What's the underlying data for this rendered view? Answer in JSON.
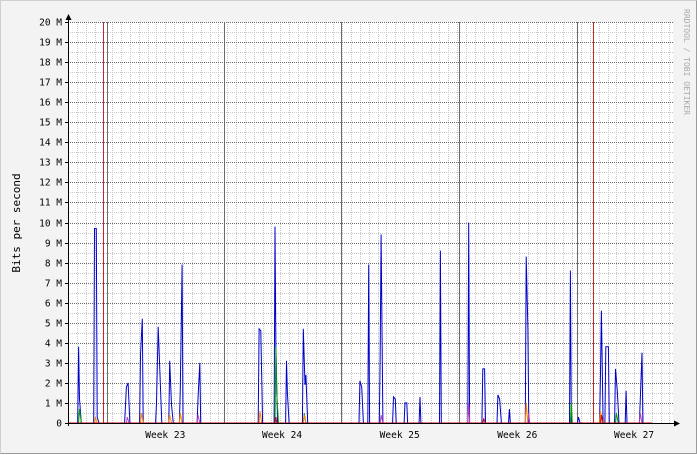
{
  "chart_data": {
    "type": "line",
    "title": "",
    "ylabel": "Bits per second",
    "watermark": "RRDTOOL / TOBI OETIKER",
    "ylim": [
      0,
      20000000
    ],
    "y_ticks": [
      {
        "value": 0,
        "label": "0"
      },
      {
        "value": 1000000,
        "label": "1 M"
      },
      {
        "value": 2000000,
        "label": "2 M"
      },
      {
        "value": 3000000,
        "label": "3 M"
      },
      {
        "value": 4000000,
        "label": "4 M"
      },
      {
        "value": 5000000,
        "label": "5 M"
      },
      {
        "value": 6000000,
        "label": "6 M"
      },
      {
        "value": 7000000,
        "label": "7 M"
      },
      {
        "value": 8000000,
        "label": "8 M"
      },
      {
        "value": 9000000,
        "label": "9 M"
      },
      {
        "value": 10000000,
        "label": "10 M"
      },
      {
        "value": 11000000,
        "label": "11 M"
      },
      {
        "value": 12000000,
        "label": "12 M"
      },
      {
        "value": 13000000,
        "label": "13 M"
      },
      {
        "value": 14000000,
        "label": "14 M"
      },
      {
        "value": 15000000,
        "label": "15 M"
      },
      {
        "value": 16000000,
        "label": "16 M"
      },
      {
        "value": 17000000,
        "label": "17 M"
      },
      {
        "value": 18000000,
        "label": "18 M"
      },
      {
        "value": 19000000,
        "label": "19 M"
      },
      {
        "value": 20000000,
        "label": "20 M"
      }
    ],
    "x_unit": "day",
    "xlim": [
      0,
      31
    ],
    "week_lines": [
      2.2,
      8.8,
      15.45,
      22.1,
      28.75
    ],
    "week_labels": [
      {
        "x": 5.5,
        "label": "Week 23"
      },
      {
        "x": 12.1,
        "label": "Week 24"
      },
      {
        "x": 18.75,
        "label": "Week 25"
      },
      {
        "x": 25.4,
        "label": "Week 26"
      },
      {
        "x": 32.0,
        "label": "Week 27"
      }
    ],
    "red_markers": [
      2.0,
      29.65
    ],
    "colors": {
      "primary": "#0000cc",
      "secondary": "#cc0000",
      "tertiary": "#00a000",
      "quaternary": "#bb44bb",
      "quinary": "#ff8800",
      "grid_major": "#6a6a6a",
      "grid_minor": "#c8c8c8",
      "marker": "#cc2222",
      "axis": "#000000"
    },
    "series": [
      {
        "color_key": "primary",
        "points": [
          [
            0.0,
            0
          ],
          [
            0.55,
            0
          ],
          [
            0.6,
            3800000
          ],
          [
            0.65,
            1200000
          ],
          [
            0.75,
            0
          ],
          [
            1.45,
            0
          ],
          [
            1.5,
            9700000
          ],
          [
            1.6,
            9700000
          ],
          [
            1.65,
            300000
          ],
          [
            1.75,
            0
          ],
          [
            3.2,
            0
          ],
          [
            3.3,
            1800000
          ],
          [
            3.4,
            2000000
          ],
          [
            3.5,
            0
          ],
          [
            4.05,
            0
          ],
          [
            4.1,
            3400000
          ],
          [
            4.2,
            5200000
          ],
          [
            4.25,
            0
          ],
          [
            4.95,
            0
          ],
          [
            5.0,
            1000000
          ],
          [
            5.1,
            4800000
          ],
          [
            5.2,
            2400000
          ],
          [
            5.3,
            0
          ],
          [
            5.7,
            0
          ],
          [
            5.75,
            3100000
          ],
          [
            5.85,
            900000
          ],
          [
            5.95,
            0
          ],
          [
            6.3,
            0
          ],
          [
            6.35,
            1700000
          ],
          [
            6.45,
            7900000
          ],
          [
            6.5,
            0
          ],
          [
            7.3,
            0
          ],
          [
            7.35,
            1200000
          ],
          [
            7.45,
            3000000
          ],
          [
            7.5,
            0
          ],
          [
            10.75,
            0
          ],
          [
            10.8,
            4700000
          ],
          [
            10.9,
            4600000
          ],
          [
            11.0,
            0
          ],
          [
            11.65,
            0
          ],
          [
            11.7,
            9800000
          ],
          [
            11.75,
            3700000
          ],
          [
            11.85,
            0
          ],
          [
            12.3,
            0
          ],
          [
            12.35,
            3100000
          ],
          [
            12.4,
            1500000
          ],
          [
            12.5,
            0
          ],
          [
            13.25,
            0
          ],
          [
            13.3,
            4700000
          ],
          [
            13.4,
            1900000
          ],
          [
            13.45,
            2400000
          ],
          [
            13.55,
            0
          ],
          [
            16.45,
            0
          ],
          [
            16.5,
            2100000
          ],
          [
            16.6,
            1800000
          ],
          [
            16.7,
            0
          ],
          [
            16.95,
            0
          ],
          [
            17.0,
            7900000
          ],
          [
            17.05,
            0
          ],
          [
            17.6,
            0
          ],
          [
            17.65,
            3500000
          ],
          [
            17.7,
            9400000
          ],
          [
            17.8,
            0
          ],
          [
            18.35,
            0
          ],
          [
            18.4,
            1300000
          ],
          [
            18.5,
            1200000
          ],
          [
            18.55,
            0
          ],
          [
            19.0,
            0
          ],
          [
            19.05,
            1000000
          ],
          [
            19.15,
            1000000
          ],
          [
            19.2,
            0
          ],
          [
            19.85,
            0
          ],
          [
            19.9,
            1300000
          ],
          [
            19.95,
            0
          ],
          [
            21.0,
            0
          ],
          [
            21.05,
            8600000
          ],
          [
            21.1,
            0
          ],
          [
            22.6,
            0
          ],
          [
            22.65,
            10000000
          ],
          [
            22.7,
            0
          ],
          [
            23.4,
            0
          ],
          [
            23.45,
            2700000
          ],
          [
            23.55,
            2700000
          ],
          [
            23.6,
            0
          ],
          [
            24.25,
            0
          ],
          [
            24.3,
            1400000
          ],
          [
            24.4,
            1200000
          ],
          [
            24.5,
            0
          ],
          [
            24.9,
            0
          ],
          [
            24.95,
            700000
          ],
          [
            25.0,
            0
          ],
          [
            25.85,
            0
          ],
          [
            25.9,
            8300000
          ],
          [
            26.0,
            4700000
          ],
          [
            26.05,
            0
          ],
          [
            28.35,
            0
          ],
          [
            28.4,
            7600000
          ],
          [
            28.45,
            0
          ],
          [
            28.8,
            0
          ],
          [
            28.85,
            300000
          ],
          [
            28.95,
            0
          ],
          [
            30.05,
            0
          ],
          [
            30.1,
            2500000
          ],
          [
            30.15,
            5600000
          ],
          [
            30.25,
            0
          ],
          [
            30.35,
            0
          ],
          [
            30.4,
            3800000
          ],
          [
            30.55,
            3800000
          ],
          [
            30.6,
            0
          ],
          [
            30.9,
            0
          ],
          [
            30.95,
            2700000
          ],
          [
            31.05,
            1600000
          ],
          [
            31.15,
            0
          ],
          [
            31.5,
            0
          ],
          [
            31.55,
            1600000
          ],
          [
            31.6,
            0
          ],
          [
            32.3,
            0
          ],
          [
            32.35,
            1200000
          ],
          [
            32.45,
            3500000
          ],
          [
            32.5,
            0
          ],
          [
            33.0,
            0
          ]
        ]
      },
      {
        "color_key": "tertiary",
        "points": [
          [
            0.0,
            0
          ],
          [
            0.6,
            0
          ],
          [
            0.65,
            700000
          ],
          [
            0.75,
            0
          ],
          [
            11.7,
            0
          ],
          [
            11.75,
            3800000
          ],
          [
            11.8,
            1500000
          ],
          [
            11.9,
            0
          ],
          [
            13.3,
            0
          ],
          [
            13.35,
            500000
          ],
          [
            13.45,
            0
          ],
          [
            28.4,
            0
          ],
          [
            28.45,
            1000000
          ],
          [
            28.5,
            0
          ],
          [
            30.95,
            0
          ],
          [
            31.0,
            500000
          ],
          [
            31.1,
            0
          ],
          [
            33.0,
            0
          ]
        ]
      },
      {
        "color_key": "quinary",
        "points": [
          [
            0.0,
            0
          ],
          [
            1.5,
            0
          ],
          [
            1.55,
            300000
          ],
          [
            1.65,
            0
          ],
          [
            4.1,
            0
          ],
          [
            4.15,
            500000
          ],
          [
            4.25,
            0
          ],
          [
            5.7,
            0
          ],
          [
            5.75,
            400000
          ],
          [
            5.85,
            0
          ],
          [
            6.3,
            0
          ],
          [
            6.35,
            500000
          ],
          [
            6.45,
            0
          ],
          [
            10.8,
            0
          ],
          [
            10.85,
            600000
          ],
          [
            10.95,
            0
          ],
          [
            13.3,
            0
          ],
          [
            13.35,
            400000
          ],
          [
            13.45,
            0
          ],
          [
            25.85,
            0
          ],
          [
            25.9,
            1000000
          ],
          [
            26.0,
            0
          ],
          [
            30.05,
            0
          ],
          [
            30.1,
            600000
          ],
          [
            30.2,
            0
          ],
          [
            33.0,
            0
          ]
        ]
      },
      {
        "color_key": "quaternary",
        "points": [
          [
            0.0,
            0
          ],
          [
            3.3,
            0
          ],
          [
            3.35,
            300000
          ],
          [
            3.45,
            0
          ],
          [
            7.3,
            0
          ],
          [
            7.35,
            400000
          ],
          [
            7.45,
            0
          ],
          [
            17.65,
            0
          ],
          [
            17.7,
            400000
          ],
          [
            17.8,
            0
          ],
          [
            22.6,
            0
          ],
          [
            22.65,
            1000000
          ],
          [
            22.7,
            0
          ],
          [
            26.0,
            0
          ],
          [
            26.05,
            500000
          ],
          [
            26.1,
            0
          ],
          [
            32.3,
            0
          ],
          [
            32.35,
            500000
          ],
          [
            32.45,
            0
          ],
          [
            33.0,
            0
          ]
        ]
      },
      {
        "color_key": "secondary",
        "points": [
          [
            0.0,
            0
          ],
          [
            11.7,
            0
          ],
          [
            11.75,
            300000
          ],
          [
            11.8,
            0
          ],
          [
            23.45,
            0
          ],
          [
            23.5,
            200000
          ],
          [
            23.6,
            0
          ],
          [
            30.1,
            0
          ],
          [
            30.15,
            400000
          ],
          [
            30.25,
            0
          ],
          [
            33.0,
            0
          ]
        ]
      }
    ]
  }
}
